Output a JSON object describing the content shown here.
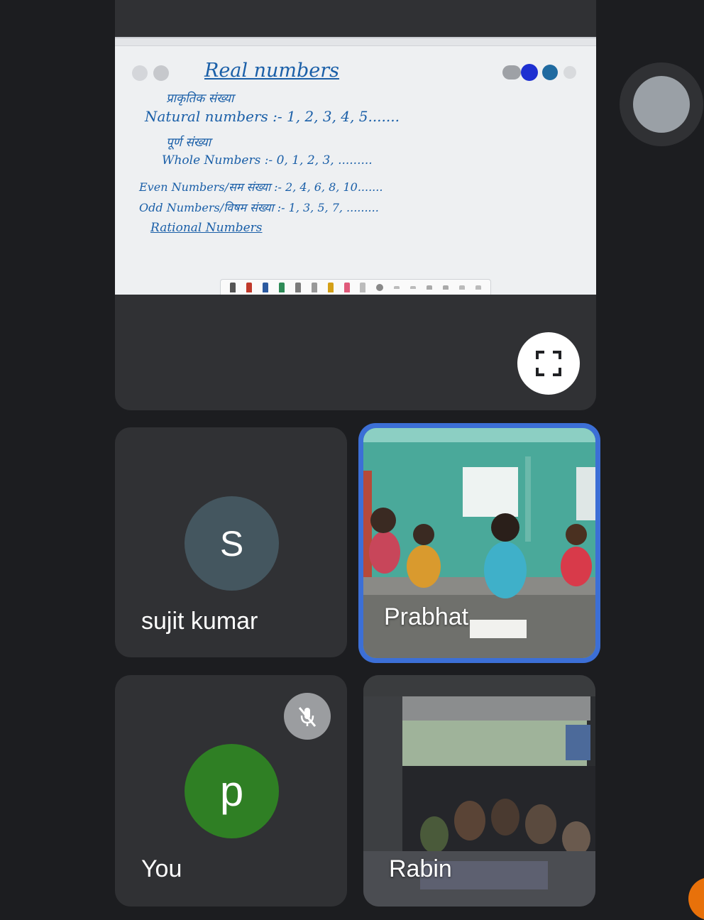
{
  "whiteboard": {
    "title": "Real numbers",
    "lines": [
      "प्राकृतिक संख्या",
      "Natural numbers :- 1, 2, 3, 4, 5.......",
      "पूर्ण संख्या",
      "Whole Numbers :- 0, 1, 2, 3, .........",
      "Even Numbers/सम संख्या :- 2, 4, 6, 8, 10.......",
      "Odd Numbers/विषम संख्या :- 1, 3, 5, 7, .........",
      "Rational Numbers"
    ]
  },
  "participants": {
    "sujit": {
      "initial": "S",
      "name": "sujit kumar"
    },
    "prabhat": {
      "name": "Prabhat"
    },
    "you": {
      "initial": "p",
      "name": "You"
    },
    "rabin": {
      "name": "Rabin"
    }
  },
  "colors": {
    "background": "#1c1d20",
    "tile": "#303134",
    "active_speaker_border": "#3c6fd6",
    "avatar_s": "#44565f",
    "avatar_p": "#2f7f24",
    "ink": "#1a5fa8"
  },
  "icons": {
    "fullscreen": "fullscreen-icon",
    "mute": "mic-off-icon"
  }
}
